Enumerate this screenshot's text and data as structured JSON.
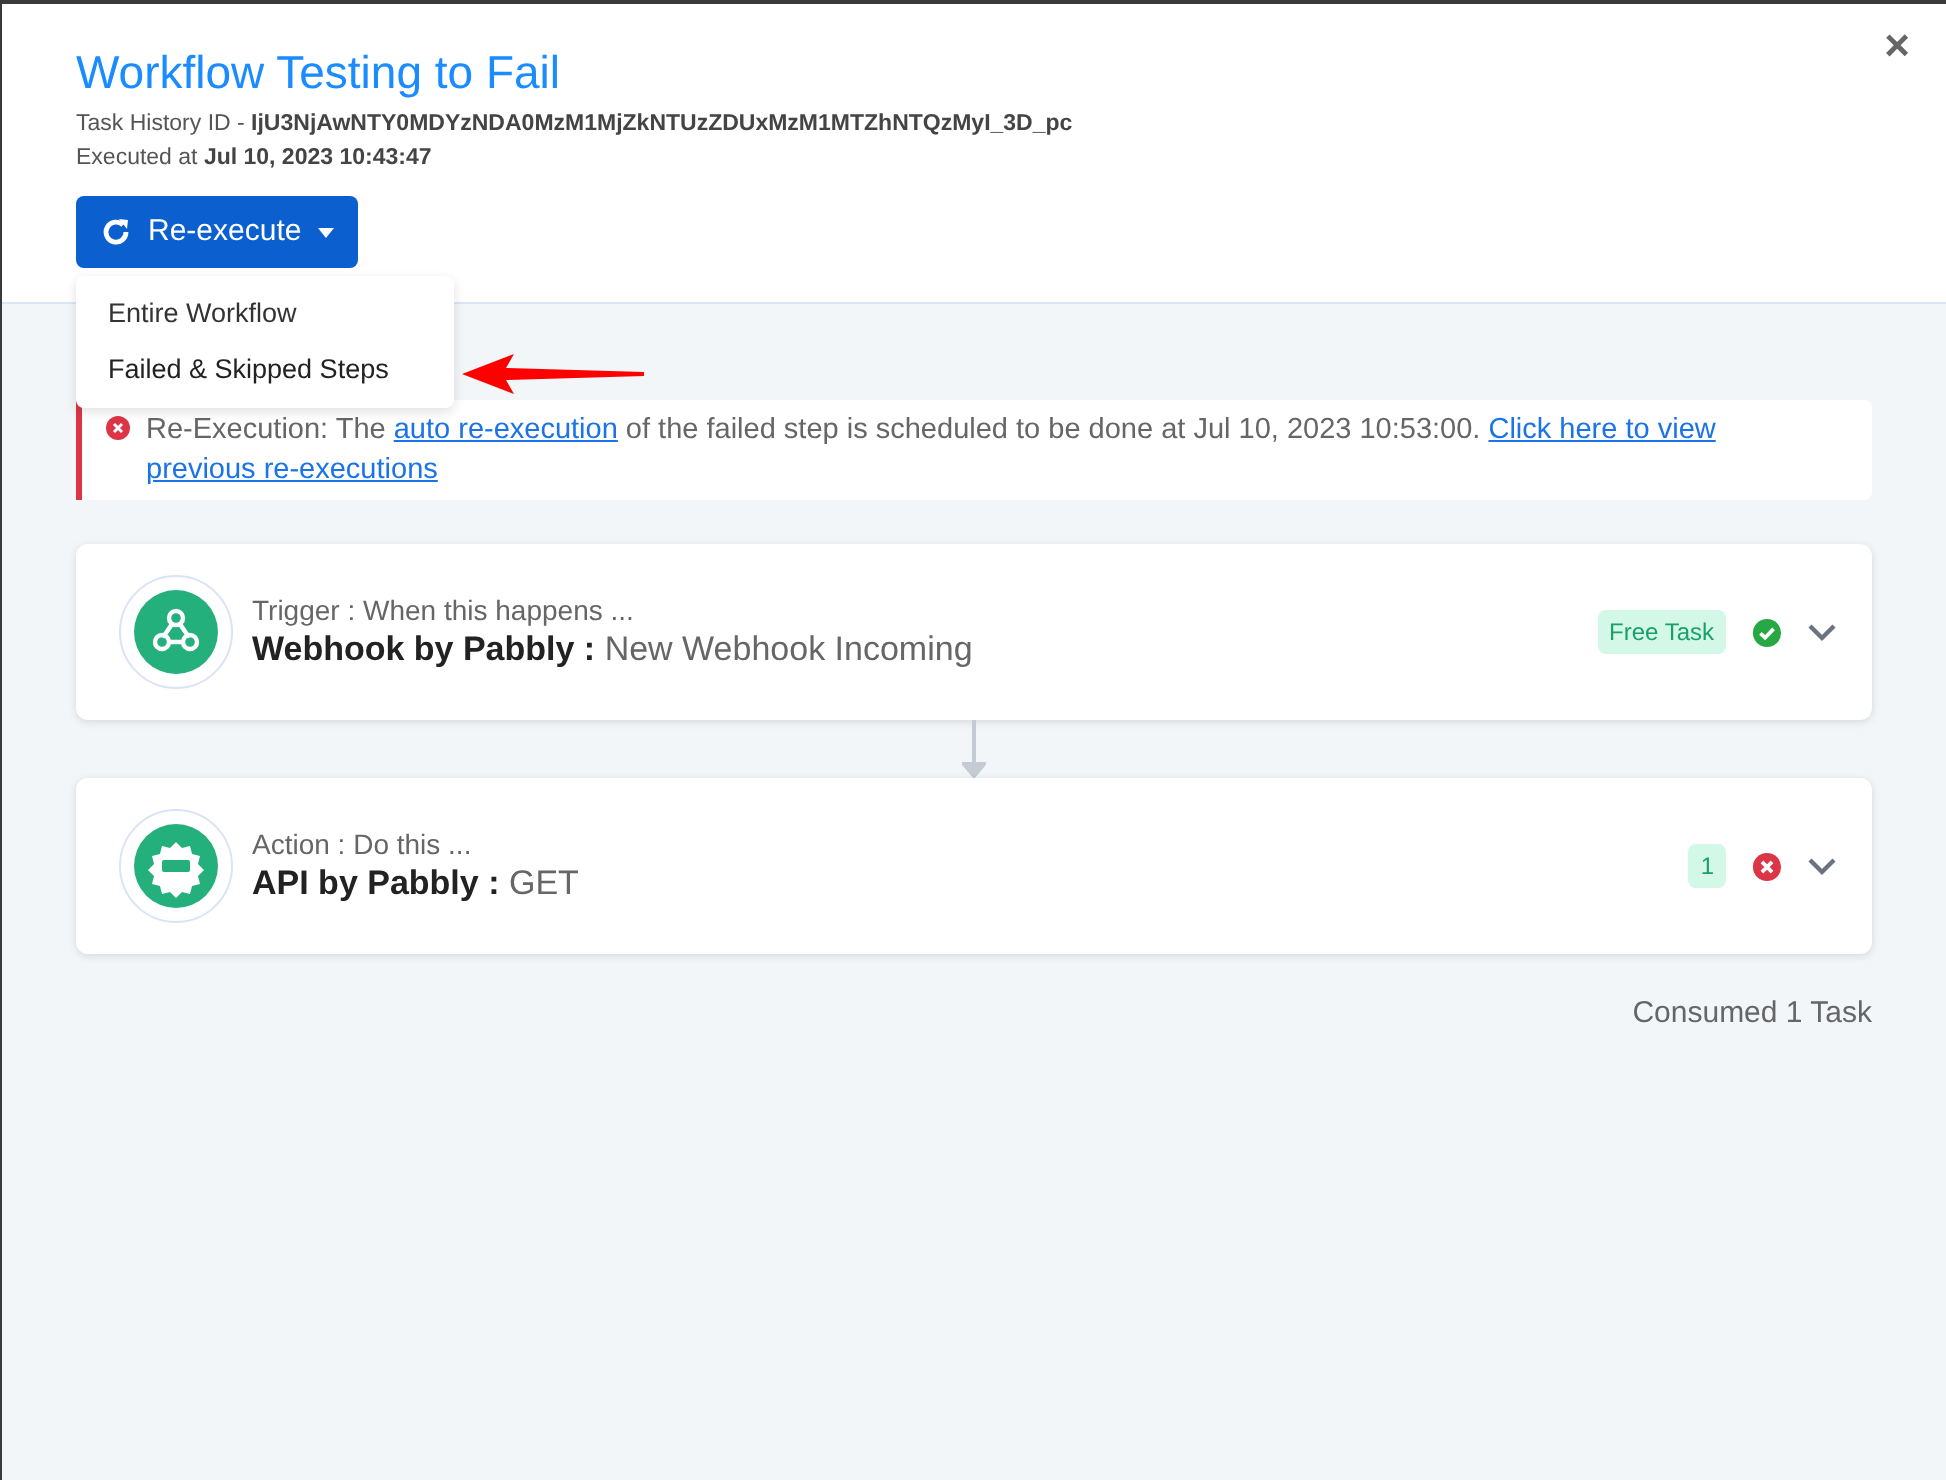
{
  "modal": {
    "title": "Workflow Testing to Fail",
    "close": "×",
    "task_history_label": "Task History ID - ",
    "task_history_id": "IjU3NjAwNTY0MDYzNDA0MzM1MjZkNTUzZDUxMzM1MTZhNTQzMyI_3D_pc",
    "executed_label": "Executed at ",
    "executed_at": "Jul 10, 2023 10:43:47"
  },
  "reexecute": {
    "label": "Re-execute",
    "expanded": true,
    "options": [
      {
        "label": "Entire Workflow",
        "selected": false
      },
      {
        "label": "Failed & Skipped Steps",
        "selected": true
      }
    ]
  },
  "alert": {
    "segments": [
      {
        "kind": "text",
        "text": "Re-Execution: The "
      },
      {
        "kind": "link",
        "text": "auto re-execution"
      },
      {
        "kind": "text",
        "text": " of the failed step is scheduled to be done at Jul 10, 2023 10:53:00. "
      },
      {
        "kind": "link",
        "text": "Click here to view"
      },
      {
        "kind": "link",
        "text": "previous re-executions"
      }
    ]
  },
  "steps": [
    {
      "kind": "webhook",
      "caption": "Trigger : When this happens ...",
      "app": "Webhook by Pabbly :",
      "event": "New Webhook Incoming",
      "badge": "Free Task",
      "failed": false
    },
    {
      "kind": "api",
      "caption": "Action : Do this ...",
      "app": "API by Pabbly :",
      "event": "GET",
      "badge": "1",
      "failed": true
    }
  ],
  "footer": "Consumed 1 Task"
}
